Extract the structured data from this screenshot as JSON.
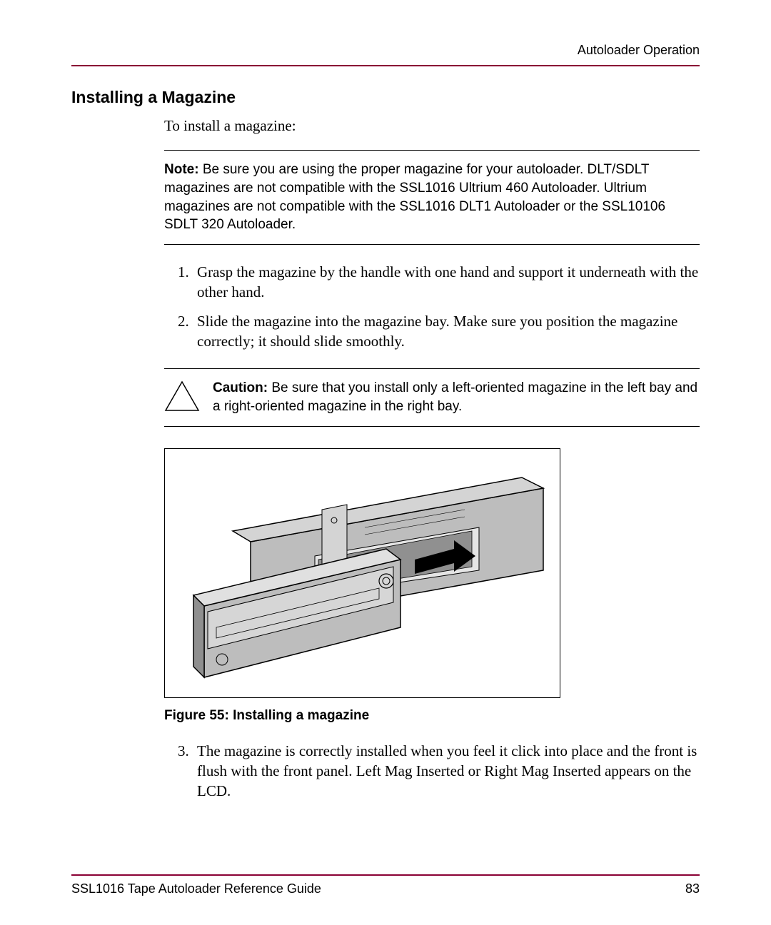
{
  "header": {
    "section": "Autoloader Operation"
  },
  "heading": "Installing a Magazine",
  "intro": "To install a magazine:",
  "note": {
    "label": "Note:",
    "text": "Be sure you are using the proper magazine for your autoloader. DLT/SDLT magazines are not compatible with the SSL1016 Ultrium 460 Autoloader. Ultrium magazines are not compatible with the SSL1016 DLT1 Autoloader or the SSL10106 SDLT 320 Autoloader."
  },
  "steps_a": [
    "Grasp the magazine by the handle with one hand and support it underneath with the other hand.",
    "Slide the magazine into the magazine bay. Make sure you position the magazine correctly; it should slide smoothly."
  ],
  "caution": {
    "label": "Caution:",
    "text": "Be sure that you install only a left-oriented magazine in the left bay and a right-oriented magazine in the right bay."
  },
  "figure": {
    "caption": "Figure 55:  Installing a magazine"
  },
  "steps_b": [
    "The magazine is correctly installed when you feel it click into place and the front is flush with the front panel. Left Mag Inserted or Right Mag Inserted appears on the LCD."
  ],
  "footer": {
    "doc_title": "SSL1016 Tape Autoloader Reference Guide",
    "page_number": "83"
  }
}
